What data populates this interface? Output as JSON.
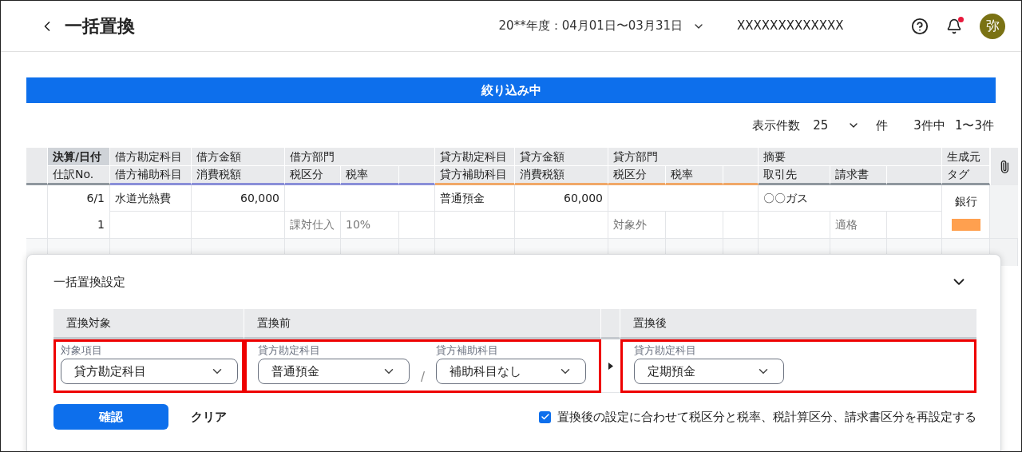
{
  "header": {
    "title": "一括置換",
    "fiscal_period": "20**年度：04月01日〜03月31日",
    "company": "XXXXXXXXXXXXX",
    "has_unread": true,
    "avatar": "弥"
  },
  "filter_banner": "絞り込み中",
  "pagination": {
    "label": "表示件数",
    "per_page": "25",
    "unit": "件",
    "total": "3件中",
    "range": "1〜3件"
  },
  "table": {
    "groups": [
      {
        "kind": "key",
        "label": "決算/日付",
        "sub": [
          "仕訳No."
        ]
      },
      {
        "kind": "debit",
        "label": "借方勘定科目",
        "sub": [
          "借方補助科目"
        ]
      },
      {
        "kind": "debit",
        "label": "借方金額",
        "sub": [
          "消費税額"
        ]
      },
      {
        "kind": "debit",
        "label": "借方部門",
        "sub": [
          "税区分",
          "税率"
        ],
        "trailing_blank": true
      },
      {
        "kind": "credit",
        "label": "貸方勘定科目",
        "sub": [
          "貸方補助科目"
        ]
      },
      {
        "kind": "credit",
        "label": "貸方金額",
        "sub": [
          "消費税額"
        ]
      },
      {
        "kind": "credit",
        "label": "貸方部門",
        "sub": [
          "税区分",
          "税率"
        ],
        "trailing_blank": true
      },
      {
        "kind": "neutral",
        "label": "摘要",
        "sub": [
          "取引先",
          "請求書"
        ],
        "trailing_blank": true
      },
      {
        "kind": "neutral",
        "label": "生成元",
        "sub": [
          "タグ"
        ]
      }
    ],
    "rows": [
      {
        "date": "6/1",
        "no": "1",
        "debit_account": "水道光熱費",
        "debit_amount": "60,000",
        "debit_tax_category": "課対仕入",
        "debit_tax_rate": "10%",
        "credit_account": "普通預金",
        "credit_amount": "60,000",
        "credit_tax_category": "対象外",
        "memo": "〇〇ガス",
        "invoice": "適格",
        "source": "銀行",
        "tag": {
          "color": "#ffa04f"
        }
      }
    ]
  },
  "panel": {
    "title": "一括置換設定",
    "expanded": true,
    "columns": [
      "置換対象",
      "置換前",
      "置換後"
    ],
    "target": {
      "highlighted": true,
      "label": "対象項目",
      "value": "貸方勘定科目"
    },
    "before": {
      "highlighted": true,
      "separator": "/",
      "fields": [
        {
          "label": "貸方勘定科目",
          "value": "普通預金"
        },
        {
          "label": "貸方補助科目",
          "value": "補助科目なし"
        }
      ]
    },
    "after": {
      "highlighted": true,
      "label": "貸方勘定科目",
      "value": "定期預金"
    },
    "confirm": "確認",
    "clear": "クリア",
    "reset_option": {
      "checked": true,
      "label": "置換後の設定に合わせて税区分と税率、税計算区分、請求書区分を再設定する"
    }
  }
}
